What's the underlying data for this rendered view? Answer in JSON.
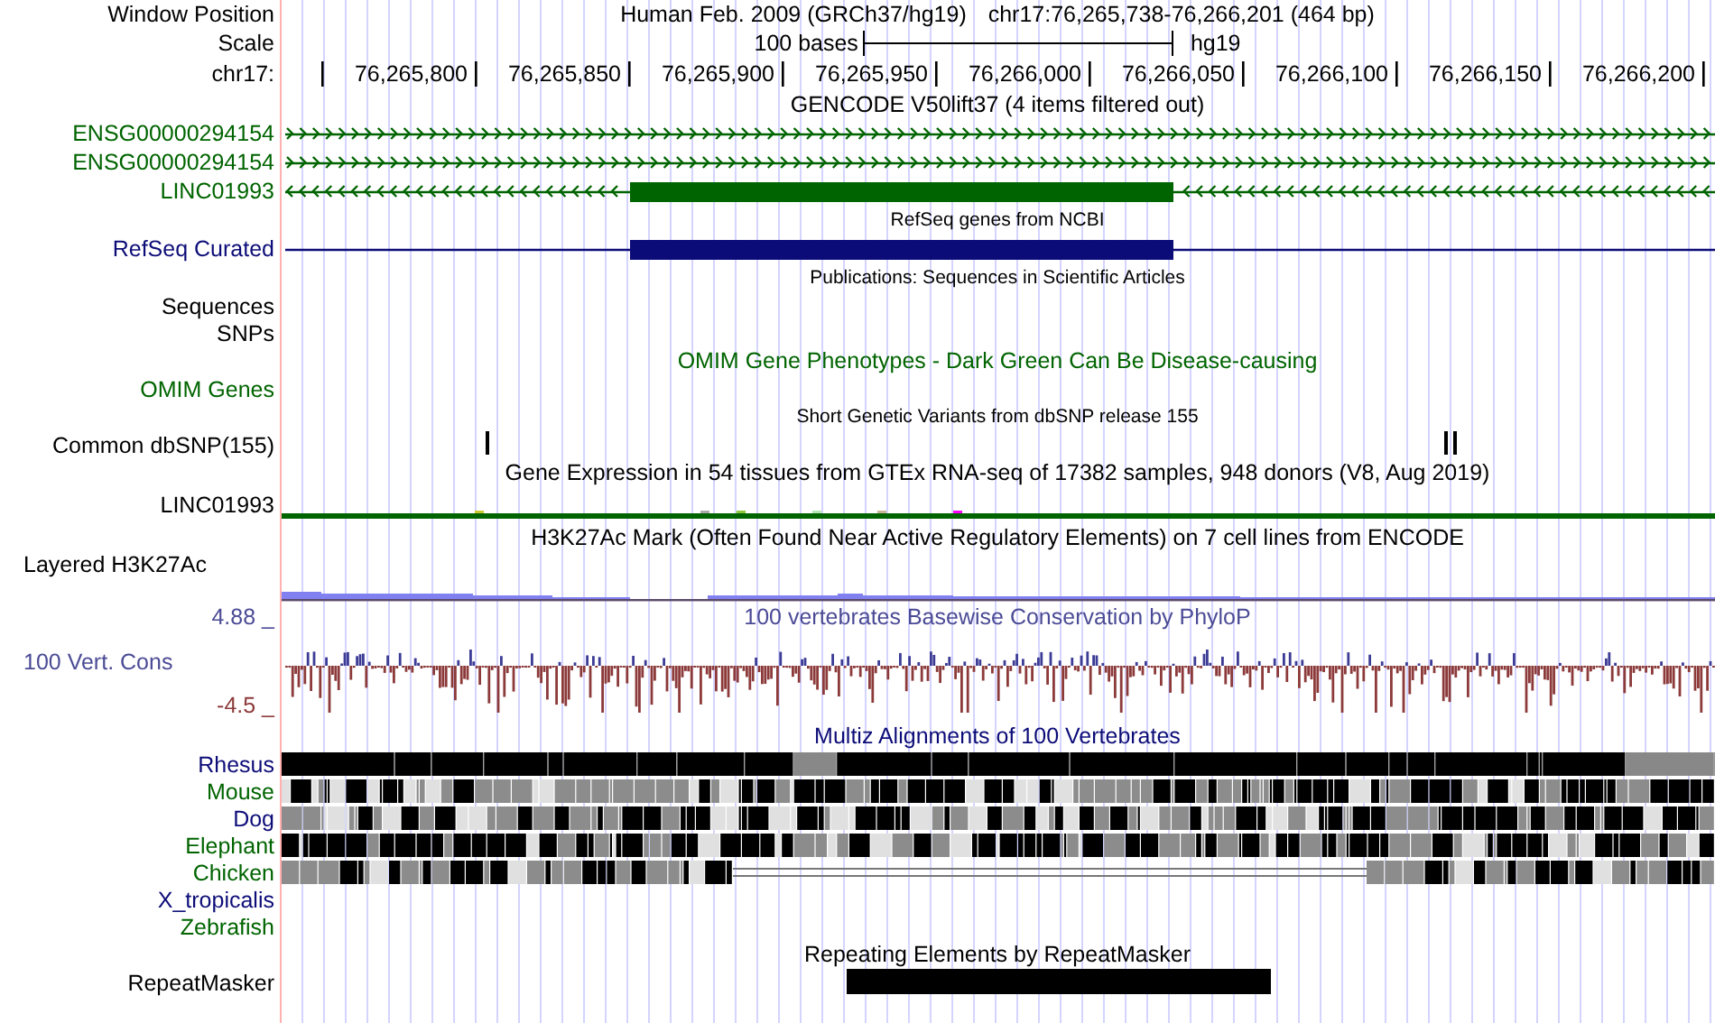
{
  "header": {
    "window_label": "Window Position",
    "assembly": "Human Feb. 2009 (GRCh37/hg19)",
    "position": "chr17:76,265,738-76,266,201 (464 bp)",
    "scale_label": "Scale",
    "scale_text": "100 bases",
    "scale_db": "hg19",
    "chrom_label": "chr17:",
    "ticks": [
      "76,265,800",
      "76,265,850",
      "76,265,900",
      "76,265,950",
      "76,266,000",
      "76,266,050",
      "76,266,100",
      "76,266,150",
      "76,266,200"
    ]
  },
  "tracks": [
    {
      "kind": "title",
      "text": "GENCODE V50lift37 (4 items filtered out)",
      "color": "#000000"
    },
    {
      "kind": "gene",
      "label": "ENSG00000294154",
      "color": "#006400",
      "arrows": true,
      "reverse": false,
      "exon": false
    },
    {
      "kind": "gene",
      "label": "ENSG00000294154",
      "color": "#006400",
      "arrows": true,
      "reverse": false,
      "exon": false
    },
    {
      "kind": "gene",
      "label": "LINC01993",
      "color": "#006400",
      "arrows": true,
      "reverse": true,
      "exon": true
    },
    {
      "kind": "note",
      "text": "RefSeq genes from NCBI"
    },
    {
      "kind": "gene",
      "label": "RefSeq Curated",
      "color": "#0c0c78",
      "arrows": false,
      "exon": true
    },
    {
      "kind": "note",
      "text": "Publications: Sequences in Scientific Articles"
    },
    {
      "kind": "empty",
      "label": "Sequences",
      "color": "#000000"
    },
    {
      "kind": "empty",
      "label": "SNPs",
      "color": "#000000"
    },
    {
      "kind": "title",
      "text": "OMIM Gene Phenotypes - Dark Green Can Be Disease-causing",
      "color": "#006400"
    },
    {
      "kind": "empty",
      "label": "OMIM Genes",
      "color": "#006400"
    },
    {
      "kind": "note",
      "text": "Short Genetic Variants from dbSNP release 155"
    },
    {
      "kind": "snp",
      "label": "Common dbSNP(155)",
      "color": "#000000"
    },
    {
      "kind": "title",
      "text": "Gene Expression in 54 tissues from GTEx RNA-seq of 17382 samples, 948 donors (V8, Aug 2019)",
      "color": "#000000"
    },
    {
      "kind": "gtex",
      "label": "LINC01993",
      "color": "#000000"
    },
    {
      "kind": "title",
      "text": "H3K27Ac Mark (Often Found Near Active Regulatory Elements) on 7 cell lines from ENCODE",
      "color": "#000000"
    },
    {
      "kind": "layered",
      "label": "Layered H3K27Ac",
      "color": "#000000"
    },
    {
      "kind": "wiggle",
      "label": "100 Vert. Cons",
      "title": "100 vertebrates Basewise Conservation by PhyloP",
      "max": "4.88 _",
      "min": "-4.5 _",
      "color": "#4b4b96"
    },
    {
      "kind": "title",
      "text": "Multiz Alignments of 100 Vertebrates",
      "color": "#0c0c78"
    },
    {
      "kind": "multiz",
      "species": [
        {
          "label": "Rhesus",
          "color": "#0c0c78",
          "kind": "close"
        },
        {
          "label": "Mouse",
          "color": "#006400",
          "kind": "full"
        },
        {
          "label": "Dog",
          "color": "#0c0c78",
          "kind": "full"
        },
        {
          "label": "Elephant",
          "color": "#006400",
          "kind": "full"
        },
        {
          "label": "Chicken",
          "color": "#006400",
          "kind": "gapped"
        },
        {
          "label": "X_tropicalis",
          "color": "#0c0c78",
          "kind": "none"
        },
        {
          "label": "Zebrafish",
          "color": "#006400",
          "kind": "none"
        }
      ]
    },
    {
      "kind": "title",
      "text": "Repeating Elements by RepeatMasker",
      "color": "#000000"
    },
    {
      "kind": "repeat",
      "label": "RepeatMasker",
      "color": "#000000"
    }
  ]
}
